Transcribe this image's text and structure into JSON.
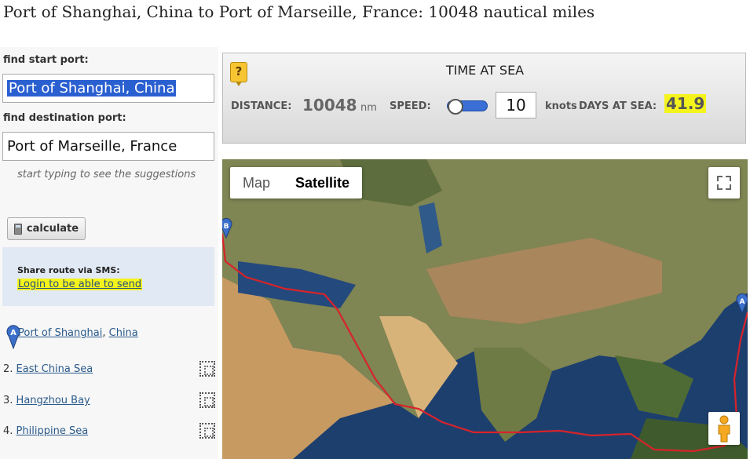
{
  "title": "Port of Shanghai, China to Port of Marseille, France: 10048 nautical miles",
  "form": {
    "start_label": "find start port:",
    "start_value": "Port of Shanghai, China",
    "dest_label": "find destination port:",
    "dest_value": "Port of Marseille, France",
    "hint": "start typing to see the suggestions",
    "calculate_label": "calculate"
  },
  "sms": {
    "label": "Share route via SMS:",
    "link": "Login to be able to send"
  },
  "route": {
    "start_port": "Port of Shanghai",
    "start_sep": ",",
    "start_country": "China",
    "pin_a": "A",
    "steps": [
      {
        "num": "2.",
        "name": "East China Sea"
      },
      {
        "num": "3.",
        "name": "Hangzhou Bay"
      },
      {
        "num": "4.",
        "name": "Philippine Sea"
      }
    ]
  },
  "time_at_sea": {
    "help": "?",
    "title": "TIME AT SEA",
    "distance_label": "DISTANCE:",
    "distance_value": "10048",
    "distance_unit": "nm",
    "speed_label": "SPEED:",
    "speed_value": "10",
    "speed_unit": "knots",
    "days_label": "DAYS AT SEA:",
    "days_value": "41.9"
  },
  "map": {
    "tab_map": "Map",
    "tab_satellite": "Satellite",
    "active_tab": "Satellite",
    "pin_a": "A",
    "pin_b": "B",
    "route_color": "#d8232a"
  },
  "icons": {
    "help": "help-icon",
    "calculator": "calculator-icon",
    "fullscreen": "fullscreen-icon",
    "pegman": "pegman-icon",
    "step": "step-icon"
  }
}
